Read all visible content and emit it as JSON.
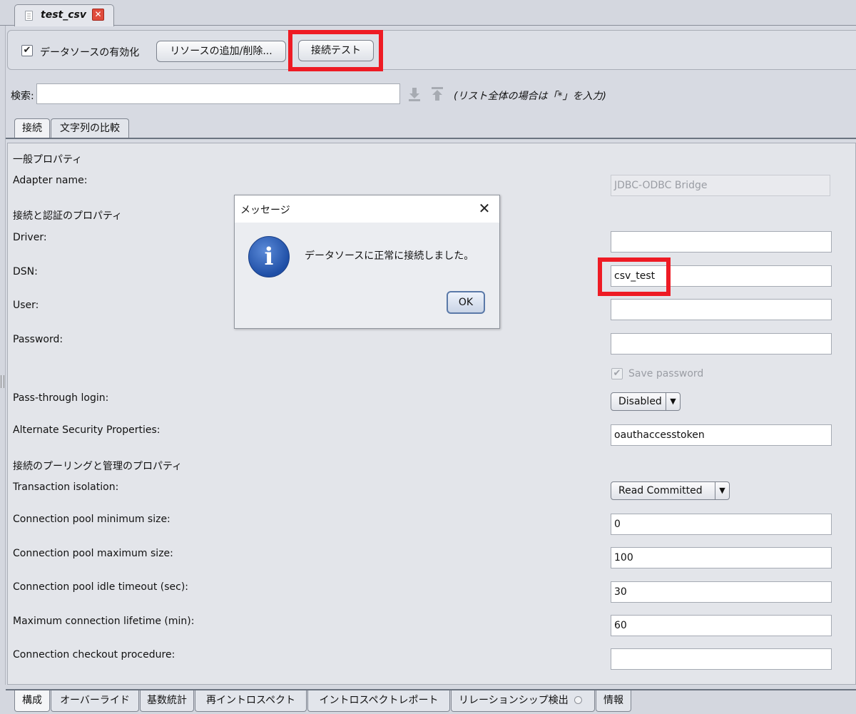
{
  "editor_tab": {
    "title": "test_csv",
    "close_glyph": "✕"
  },
  "toolbar": {
    "enable_label": "データソースの有効化",
    "enable_checked": true,
    "add_remove_label": "リソースの追加/削除...",
    "test_connection_label": "接続テスト"
  },
  "search": {
    "label": "検索:",
    "value": "",
    "hint": "(リスト全体の場合は「*」を入力)"
  },
  "inner_tabs": [
    {
      "label": "接続"
    },
    {
      "label": "文字列の比較"
    }
  ],
  "content": {
    "general_section": "一般プロパティ",
    "adapter_name_label": "Adapter name:",
    "adapter_name_value": "JDBC-ODBC Bridge",
    "auth_section": "接続と認証のプロパティ",
    "driver_label": "Driver:",
    "driver_value": "",
    "dsn_label": "DSN:",
    "dsn_value": "csv_test",
    "user_label": "User:",
    "user_value": "",
    "password_label": "Password:",
    "password_value": "",
    "save_password_label": "Save password",
    "passthrough_label": "Pass-through login:",
    "passthrough_value": "Disabled",
    "alt_security_label": "Alternate Security Properties:",
    "alt_security_value": "oauthaccesstoken",
    "pool_section": "接続のプーリングと管理のプロパティ",
    "isolation_label": "Transaction isolation:",
    "isolation_value": "Read Committed",
    "pool_min_label": "Connection pool minimum size:",
    "pool_min_value": "0",
    "pool_max_label": "Connection pool maximum size:",
    "pool_max_value": "100",
    "idle_timeout_label": "Connection pool idle timeout (sec):",
    "idle_timeout_value": "30",
    "max_lifetime_label": "Maximum connection lifetime (min):",
    "max_lifetime_value": "60",
    "checkout_proc_label": "Connection checkout procedure:",
    "checkout_proc_value": ""
  },
  "bottom_tabs": [
    {
      "label": "構成"
    },
    {
      "label": "オーバーライド"
    },
    {
      "label": "基数統計"
    },
    {
      "label": "再イントロスペクト"
    },
    {
      "label": "イントロスペクトレポート"
    },
    {
      "label": "リレーションシップ検出"
    },
    {
      "label": "情報"
    }
  ],
  "dialog": {
    "title": "メッセージ",
    "message": "データソースに正常に接続しました。",
    "ok_label": "OK",
    "icon": "info-icon"
  },
  "colors": {
    "highlight": "#ee1b24",
    "info_icon": "#2b5cb5"
  }
}
